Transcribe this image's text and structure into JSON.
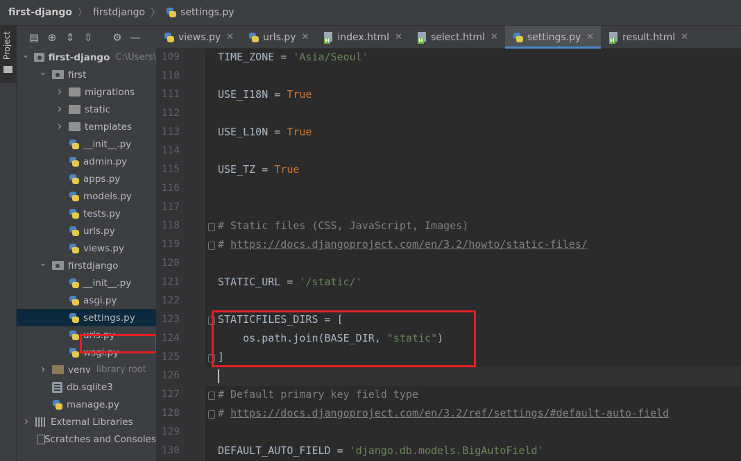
{
  "breadcrumb": [
    "first-django",
    "firstdjango",
    "settings.py"
  ],
  "toolstrip": {
    "project_label": "Project"
  },
  "project_tree": [
    {
      "label": "first-django",
      "hint": "C:\\Users\\",
      "depth": 0,
      "type": "root",
      "expanded": true
    },
    {
      "label": "first",
      "depth": 1,
      "type": "module-folder",
      "expanded": true
    },
    {
      "label": "migrations",
      "depth": 2,
      "type": "folder",
      "expanded": false
    },
    {
      "label": "static",
      "depth": 2,
      "type": "folder",
      "expanded": false
    },
    {
      "label": "templates",
      "depth": 2,
      "type": "folder",
      "expanded": false
    },
    {
      "label": "__init__.py",
      "depth": 2,
      "type": "python"
    },
    {
      "label": "admin.py",
      "depth": 2,
      "type": "python"
    },
    {
      "label": "apps.py",
      "depth": 2,
      "type": "python"
    },
    {
      "label": "models.py",
      "depth": 2,
      "type": "python"
    },
    {
      "label": "tests.py",
      "depth": 2,
      "type": "python"
    },
    {
      "label": "urls.py",
      "depth": 2,
      "type": "python"
    },
    {
      "label": "views.py",
      "depth": 2,
      "type": "python"
    },
    {
      "label": "firstdjango",
      "depth": 1,
      "type": "module-folder",
      "expanded": true
    },
    {
      "label": "__init__.py",
      "depth": 2,
      "type": "python"
    },
    {
      "label": "asgi.py",
      "depth": 2,
      "type": "python"
    },
    {
      "label": "settings.py",
      "depth": 2,
      "type": "python",
      "selected": true
    },
    {
      "label": "urls.py",
      "depth": 2,
      "type": "python"
    },
    {
      "label": "wsgi.py",
      "depth": 2,
      "type": "python"
    },
    {
      "label": "venv",
      "hint": "library root",
      "depth": 1,
      "type": "venv-folder",
      "expanded": false
    },
    {
      "label": "db.sqlite3",
      "depth": 1,
      "type": "db"
    },
    {
      "label": "manage.py",
      "depth": 1,
      "type": "python"
    },
    {
      "label": "External Libraries",
      "depth": 0,
      "type": "libs",
      "expanded": false
    },
    {
      "label": "Scratches and Consoles",
      "depth": 0,
      "type": "scratches"
    }
  ],
  "tabs": [
    {
      "label": "views.py",
      "icon": "python-icon",
      "active": false
    },
    {
      "label": "urls.py",
      "icon": "python-icon",
      "active": false
    },
    {
      "label": "index.html",
      "icon": "html-icon",
      "active": false
    },
    {
      "label": "select.html",
      "icon": "html-icon",
      "active": false
    },
    {
      "label": "settings.py",
      "icon": "python-icon",
      "active": true
    },
    {
      "label": "result.html",
      "icon": "html-icon",
      "active": false
    }
  ],
  "editor": {
    "current_line": 126,
    "lines": [
      {
        "n": 109,
        "tokens": [
          [
            "TIME_ZONE = ",
            "p"
          ],
          [
            "'Asia/Seoul'",
            "str"
          ]
        ]
      },
      {
        "n": 110,
        "tokens": []
      },
      {
        "n": 111,
        "tokens": [
          [
            "USE_I18N = ",
            "p"
          ],
          [
            "True",
            "kw"
          ]
        ]
      },
      {
        "n": 112,
        "tokens": []
      },
      {
        "n": 113,
        "tokens": [
          [
            "USE_L10N = ",
            "p"
          ],
          [
            "True",
            "kw"
          ]
        ]
      },
      {
        "n": 114,
        "tokens": []
      },
      {
        "n": 115,
        "tokens": [
          [
            "USE_TZ = ",
            "p"
          ],
          [
            "True",
            "kw"
          ]
        ]
      },
      {
        "n": 116,
        "tokens": []
      },
      {
        "n": 117,
        "tokens": []
      },
      {
        "n": 118,
        "fold": true,
        "tokens": [
          [
            "# Static files (CSS, JavaScript, Images)",
            "cm"
          ]
        ]
      },
      {
        "n": 119,
        "fold": true,
        "tokens": [
          [
            "# ",
            "cm"
          ],
          [
            "https://docs.djangoproject.com/en/3.2/howto/static-files/",
            "lnk"
          ]
        ]
      },
      {
        "n": 120,
        "tokens": []
      },
      {
        "n": 121,
        "tokens": [
          [
            "STATIC_URL = ",
            "p"
          ],
          [
            "'/static/'",
            "str"
          ]
        ]
      },
      {
        "n": 122,
        "tokens": []
      },
      {
        "n": 123,
        "fold": true,
        "tokens": [
          [
            "STATICFILES_DIRS = [",
            "p"
          ]
        ]
      },
      {
        "n": 124,
        "tokens": [
          [
            "    os.path.join(BASE_DIR, ",
            "p"
          ],
          [
            "\"static\"",
            "str"
          ],
          [
            ")",
            "p"
          ]
        ]
      },
      {
        "n": 125,
        "fold": true,
        "tokens": [
          [
            "]",
            "p"
          ]
        ]
      },
      {
        "n": 126,
        "caret": true,
        "tokens": []
      },
      {
        "n": 127,
        "fold": true,
        "tokens": [
          [
            "# Default primary key field type",
            "cm"
          ]
        ]
      },
      {
        "n": 128,
        "fold": true,
        "tokens": [
          [
            "# ",
            "cm"
          ],
          [
            "https://docs.djangoproject.com/en/3.2/ref/settings/#default-auto-field",
            "lnk"
          ]
        ]
      },
      {
        "n": 129,
        "tokens": []
      },
      {
        "n": 130,
        "tokens": [
          [
            "DEFAULT_AUTO_FIELD = ",
            "p"
          ],
          [
            "'django.db.models.BigAutoField'",
            "str"
          ]
        ]
      }
    ]
  },
  "colors": {
    "highlight_box": "#e41e25",
    "active_tab_underline": "#4a88c7"
  }
}
